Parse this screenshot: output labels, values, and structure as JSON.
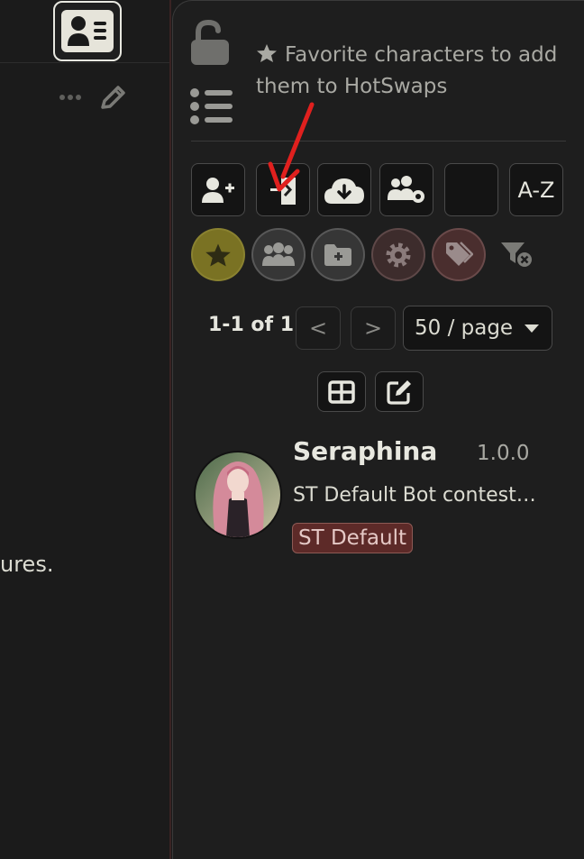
{
  "chat": {
    "visible_text_fragment": "ures.",
    "more_icon": "ellipsis-icon",
    "edit_icon": "pencil-icon"
  },
  "top_button": {
    "icon": "address-card-icon"
  },
  "panel": {
    "hint": "Favorite characters to add them to HotSwaps",
    "lock_icon": "unlocked-padlock-icon",
    "list_icon": "list-icon"
  },
  "toolbar": [
    {
      "icon": "add-user-icon"
    },
    {
      "icon": "import-file-icon"
    },
    {
      "icon": "cloud-download-icon"
    },
    {
      "icon": "users-gear-icon"
    },
    {
      "icon": "empty"
    },
    {
      "icon": "sort-az-icon",
      "label": "A-Z"
    }
  ],
  "filters": [
    {
      "icon": "star-icon",
      "active": true
    },
    {
      "icon": "users-icon"
    },
    {
      "icon": "folder-plus-icon"
    },
    {
      "icon": "gear-icon"
    },
    {
      "icon": "tags-icon"
    },
    {
      "icon": "filter-clear-icon"
    }
  ],
  "pager": {
    "count": "1-1 of 1",
    "prev": "<",
    "next": ">",
    "page_size": "50 / page"
  },
  "view_buttons": [
    {
      "icon": "grid-icon"
    },
    {
      "icon": "bulk-edit-icon"
    }
  ],
  "character": {
    "name": "Seraphina",
    "version": "1.0.0",
    "description": "ST Default Bot contest…",
    "tag": "ST Default"
  },
  "colors": {
    "accent_red_arrow": "#e0201e",
    "star_active": "#7a7223",
    "tag_bg": "#5d2a28"
  }
}
